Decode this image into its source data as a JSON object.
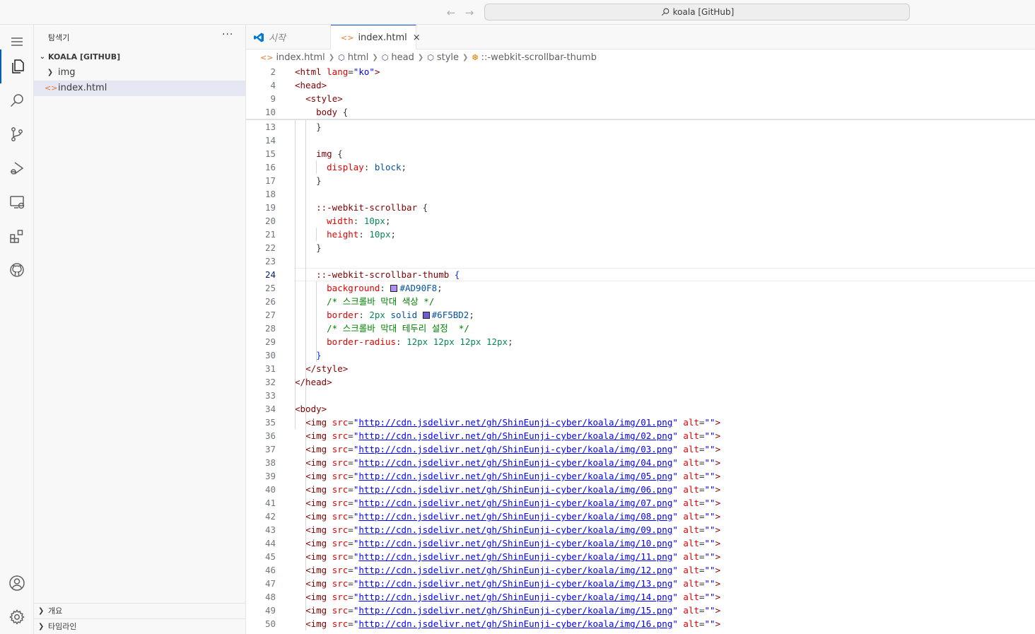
{
  "titlebar": {
    "search_text": "koala [GitHub]",
    "back_icon": "arrow-left-icon",
    "forward_icon": "arrow-right-icon"
  },
  "activity_bar": {
    "items": [
      "explorer",
      "search",
      "source-control",
      "run-and-debug",
      "remote-explorer",
      "extensions",
      "github"
    ],
    "bottom": [
      "accounts",
      "manage"
    ]
  },
  "sidebar": {
    "title": "탐색기",
    "more": "···",
    "root_label": "KOALA [GITHUB]",
    "folder_label": "img",
    "file_label": "index.html",
    "outline_label": "개요",
    "timeline_label": "타임라인"
  },
  "tabs": {
    "welcome": "시작",
    "index": "index.html",
    "close": "×"
  },
  "breadcrumb": {
    "file": "index.html",
    "html": "html",
    "head": "head",
    "style": "style",
    "selector": "::-webkit-scrollbar-thumb"
  },
  "colors": {
    "swatch1": "#AD90F8",
    "swatch2": "#6F5BD2",
    "accent": "#005fb8"
  },
  "editor": {
    "current_line": "24",
    "sticky": [
      {
        "n": "2",
        "indent": "",
        "tokens": [
          [
            "t-tag",
            "<html "
          ],
          [
            "t-attr",
            "lang"
          ],
          [
            "t-pun",
            "="
          ],
          [
            "t-str",
            "\"ko\""
          ],
          [
            "t-tag",
            ">"
          ]
        ]
      },
      {
        "n": "4",
        "indent": "",
        "tokens": [
          [
            "t-tag",
            "<head>"
          ]
        ]
      },
      {
        "n": "9",
        "indent": "  ",
        "tokens": [
          [
            "t-tag",
            "<style>"
          ]
        ]
      },
      {
        "n": "10",
        "indent": "    ",
        "tokens": [
          [
            "t-sel",
            "body "
          ],
          [
            "t-pun",
            "{"
          ]
        ]
      }
    ],
    "lines": [
      {
        "n": "13",
        "indent": "    ",
        "tokens": [
          [
            "t-pun",
            "}"
          ]
        ]
      },
      {
        "n": "14",
        "indent": "",
        "tokens": []
      },
      {
        "n": "15",
        "indent": "    ",
        "tokens": [
          [
            "t-sel",
            "img "
          ],
          [
            "t-pun",
            "{"
          ]
        ]
      },
      {
        "n": "16",
        "indent": "      ",
        "tokens": [
          [
            "t-prop",
            "display"
          ],
          [
            "t-pun",
            ": "
          ],
          [
            "t-val",
            "block"
          ],
          [
            "t-pun",
            ";"
          ]
        ]
      },
      {
        "n": "17",
        "indent": "    ",
        "tokens": [
          [
            "t-pun",
            "}"
          ]
        ]
      },
      {
        "n": "18",
        "indent": "",
        "tokens": []
      },
      {
        "n": "19",
        "indent": "    ",
        "tokens": [
          [
            "t-sel",
            "::-webkit-scrollbar "
          ],
          [
            "t-pun",
            "{"
          ]
        ]
      },
      {
        "n": "20",
        "indent": "      ",
        "tokens": [
          [
            "t-prop",
            "width"
          ],
          [
            "t-pun",
            ": "
          ],
          [
            "t-num",
            "10px"
          ],
          [
            "t-pun",
            ";"
          ]
        ]
      },
      {
        "n": "21",
        "indent": "      ",
        "tokens": [
          [
            "t-prop",
            "height"
          ],
          [
            "t-pun",
            ": "
          ],
          [
            "t-num",
            "10px"
          ],
          [
            "t-pun",
            ";"
          ]
        ]
      },
      {
        "n": "22",
        "indent": "    ",
        "tokens": [
          [
            "t-pun",
            "}"
          ]
        ]
      },
      {
        "n": "23",
        "indent": "",
        "tokens": []
      },
      {
        "n": "24",
        "indent": "    ",
        "tokens": [
          [
            "t-sel",
            "::-webkit-scrollbar-thumb "
          ],
          [
            "t-brace",
            "{"
          ]
        ]
      },
      {
        "n": "25",
        "indent": "      ",
        "tokens": [
          [
            "t-prop",
            "background"
          ],
          [
            "t-pun",
            ": "
          ],
          [
            "swatch",
            "#AD90F8"
          ],
          [
            "t-val",
            "#AD90F8"
          ],
          [
            "t-pun",
            ";"
          ]
        ]
      },
      {
        "n": "26",
        "indent": "      ",
        "tokens": [
          [
            "t-com",
            "/* 스크롤바 막대 색상 */"
          ]
        ]
      },
      {
        "n": "27",
        "indent": "      ",
        "tokens": [
          [
            "t-prop",
            "border"
          ],
          [
            "t-pun",
            ": "
          ],
          [
            "t-num",
            "2px "
          ],
          [
            "t-val",
            "solid "
          ],
          [
            "swatch",
            "#6F5BD2"
          ],
          [
            "t-val",
            "#6F5BD2"
          ],
          [
            "t-pun",
            ";"
          ]
        ]
      },
      {
        "n": "28",
        "indent": "      ",
        "tokens": [
          [
            "t-com",
            "/* 스크롤바 막대 테두리 설정  */"
          ]
        ]
      },
      {
        "n": "29",
        "indent": "      ",
        "tokens": [
          [
            "t-prop",
            "border-radius"
          ],
          [
            "t-pun",
            ": "
          ],
          [
            "t-num",
            "12px 12px 12px 12px"
          ],
          [
            "t-pun",
            ";"
          ]
        ]
      },
      {
        "n": "30",
        "indent": "    ",
        "tokens": [
          [
            "t-brace",
            "}"
          ]
        ]
      },
      {
        "n": "31",
        "indent": "  ",
        "tokens": [
          [
            "t-tag",
            "</style>"
          ]
        ]
      },
      {
        "n": "32",
        "indent": "",
        "tokens": [
          [
            "t-tag",
            "</head>"
          ]
        ]
      },
      {
        "n": "33",
        "indent": "",
        "tokens": []
      },
      {
        "n": "34",
        "indent": "",
        "tokens": [
          [
            "t-tag",
            "<body>"
          ]
        ]
      },
      {
        "n": "35",
        "indent": "  ",
        "tokens": [
          [
            "t-tag",
            "<img "
          ],
          [
            "t-attr",
            "src"
          ],
          [
            "t-pun",
            "="
          ],
          [
            "t-str",
            "\""
          ],
          [
            "t-link",
            "http://cdn.jsdelivr.net/gh/ShinEunji-cyber/koala/img/01.png"
          ],
          [
            "t-str",
            "\" "
          ],
          [
            "t-attr",
            "alt"
          ],
          [
            "t-pun",
            "="
          ],
          [
            "t-str",
            "\"\""
          ],
          [
            "t-tag",
            ">"
          ]
        ]
      },
      {
        "n": "36",
        "indent": "  ",
        "tokens": [
          [
            "t-tag",
            "<img "
          ],
          [
            "t-attr",
            "src"
          ],
          [
            "t-pun",
            "="
          ],
          [
            "t-str",
            "\""
          ],
          [
            "t-link",
            "http://cdn.jsdelivr.net/gh/ShinEunji-cyber/koala/img/02.png"
          ],
          [
            "t-str",
            "\" "
          ],
          [
            "t-attr",
            "alt"
          ],
          [
            "t-pun",
            "="
          ],
          [
            "t-str",
            "\"\""
          ],
          [
            "t-tag",
            ">"
          ]
        ]
      },
      {
        "n": "37",
        "indent": "  ",
        "tokens": [
          [
            "t-tag",
            "<img "
          ],
          [
            "t-attr",
            "src"
          ],
          [
            "t-pun",
            "="
          ],
          [
            "t-str",
            "\""
          ],
          [
            "t-link",
            "http://cdn.jsdelivr.net/gh/ShinEunji-cyber/koala/img/03.png"
          ],
          [
            "t-str",
            "\" "
          ],
          [
            "t-attr",
            "alt"
          ],
          [
            "t-pun",
            "="
          ],
          [
            "t-str",
            "\"\""
          ],
          [
            "t-tag",
            ">"
          ]
        ]
      },
      {
        "n": "38",
        "indent": "  ",
        "tokens": [
          [
            "t-tag",
            "<img "
          ],
          [
            "t-attr",
            "src"
          ],
          [
            "t-pun",
            "="
          ],
          [
            "t-str",
            "\""
          ],
          [
            "t-link",
            "http://cdn.jsdelivr.net/gh/ShinEunji-cyber/koala/img/04.png"
          ],
          [
            "t-str",
            "\" "
          ],
          [
            "t-attr",
            "alt"
          ],
          [
            "t-pun",
            "="
          ],
          [
            "t-str",
            "\"\""
          ],
          [
            "t-tag",
            ">"
          ]
        ]
      },
      {
        "n": "39",
        "indent": "  ",
        "tokens": [
          [
            "t-tag",
            "<img "
          ],
          [
            "t-attr",
            "src"
          ],
          [
            "t-pun",
            "="
          ],
          [
            "t-str",
            "\""
          ],
          [
            "t-link",
            "http://cdn.jsdelivr.net/gh/ShinEunji-cyber/koala/img/05.png"
          ],
          [
            "t-str",
            "\" "
          ],
          [
            "t-attr",
            "alt"
          ],
          [
            "t-pun",
            "="
          ],
          [
            "t-str",
            "\"\""
          ],
          [
            "t-tag",
            ">"
          ]
        ]
      },
      {
        "n": "40",
        "indent": "  ",
        "tokens": [
          [
            "t-tag",
            "<img "
          ],
          [
            "t-attr",
            "src"
          ],
          [
            "t-pun",
            "="
          ],
          [
            "t-str",
            "\""
          ],
          [
            "t-link",
            "http://cdn.jsdelivr.net/gh/ShinEunji-cyber/koala/img/06.png"
          ],
          [
            "t-str",
            "\" "
          ],
          [
            "t-attr",
            "alt"
          ],
          [
            "t-pun",
            "="
          ],
          [
            "t-str",
            "\"\""
          ],
          [
            "t-tag",
            ">"
          ]
        ]
      },
      {
        "n": "41",
        "indent": "  ",
        "tokens": [
          [
            "t-tag",
            "<img "
          ],
          [
            "t-attr",
            "src"
          ],
          [
            "t-pun",
            "="
          ],
          [
            "t-str",
            "\""
          ],
          [
            "t-link",
            "http://cdn.jsdelivr.net/gh/ShinEunji-cyber/koala/img/07.png"
          ],
          [
            "t-str",
            "\" "
          ],
          [
            "t-attr",
            "alt"
          ],
          [
            "t-pun",
            "="
          ],
          [
            "t-str",
            "\"\""
          ],
          [
            "t-tag",
            ">"
          ]
        ]
      },
      {
        "n": "42",
        "indent": "  ",
        "tokens": [
          [
            "t-tag",
            "<img "
          ],
          [
            "t-attr",
            "src"
          ],
          [
            "t-pun",
            "="
          ],
          [
            "t-str",
            "\""
          ],
          [
            "t-link",
            "http://cdn.jsdelivr.net/gh/ShinEunji-cyber/koala/img/08.png"
          ],
          [
            "t-str",
            "\" "
          ],
          [
            "t-attr",
            "alt"
          ],
          [
            "t-pun",
            "="
          ],
          [
            "t-str",
            "\"\""
          ],
          [
            "t-tag",
            ">"
          ]
        ]
      },
      {
        "n": "43",
        "indent": "  ",
        "tokens": [
          [
            "t-tag",
            "<img "
          ],
          [
            "t-attr",
            "src"
          ],
          [
            "t-pun",
            "="
          ],
          [
            "t-str",
            "\""
          ],
          [
            "t-link",
            "http://cdn.jsdelivr.net/gh/ShinEunji-cyber/koala/img/09.png"
          ],
          [
            "t-str",
            "\" "
          ],
          [
            "t-attr",
            "alt"
          ],
          [
            "t-pun",
            "="
          ],
          [
            "t-str",
            "\"\""
          ],
          [
            "t-tag",
            ">"
          ]
        ]
      },
      {
        "n": "44",
        "indent": "  ",
        "tokens": [
          [
            "t-tag",
            "<img "
          ],
          [
            "t-attr",
            "src"
          ],
          [
            "t-pun",
            "="
          ],
          [
            "t-str",
            "\""
          ],
          [
            "t-link",
            "http://cdn.jsdelivr.net/gh/ShinEunji-cyber/koala/img/10.png"
          ],
          [
            "t-str",
            "\" "
          ],
          [
            "t-attr",
            "alt"
          ],
          [
            "t-pun",
            "="
          ],
          [
            "t-str",
            "\"\""
          ],
          [
            "t-tag",
            ">"
          ]
        ]
      },
      {
        "n": "45",
        "indent": "  ",
        "tokens": [
          [
            "t-tag",
            "<img "
          ],
          [
            "t-attr",
            "src"
          ],
          [
            "t-pun",
            "="
          ],
          [
            "t-str",
            "\""
          ],
          [
            "t-link",
            "http://cdn.jsdelivr.net/gh/ShinEunji-cyber/koala/img/11.png"
          ],
          [
            "t-str",
            "\" "
          ],
          [
            "t-attr",
            "alt"
          ],
          [
            "t-pun",
            "="
          ],
          [
            "t-str",
            "\"\""
          ],
          [
            "t-tag",
            ">"
          ]
        ]
      },
      {
        "n": "46",
        "indent": "  ",
        "tokens": [
          [
            "t-tag",
            "<img "
          ],
          [
            "t-attr",
            "src"
          ],
          [
            "t-pun",
            "="
          ],
          [
            "t-str",
            "\""
          ],
          [
            "t-link",
            "http://cdn.jsdelivr.net/gh/ShinEunji-cyber/koala/img/12.png"
          ],
          [
            "t-str",
            "\" "
          ],
          [
            "t-attr",
            "alt"
          ],
          [
            "t-pun",
            "="
          ],
          [
            "t-str",
            "\"\""
          ],
          [
            "t-tag",
            ">"
          ]
        ]
      },
      {
        "n": "47",
        "indent": "  ",
        "tokens": [
          [
            "t-tag",
            "<img "
          ],
          [
            "t-attr",
            "src"
          ],
          [
            "t-pun",
            "="
          ],
          [
            "t-str",
            "\""
          ],
          [
            "t-link",
            "http://cdn.jsdelivr.net/gh/ShinEunji-cyber/koala/img/13.png"
          ],
          [
            "t-str",
            "\" "
          ],
          [
            "t-attr",
            "alt"
          ],
          [
            "t-pun",
            "="
          ],
          [
            "t-str",
            "\"\""
          ],
          [
            "t-tag",
            ">"
          ]
        ]
      },
      {
        "n": "48",
        "indent": "  ",
        "tokens": [
          [
            "t-tag",
            "<img "
          ],
          [
            "t-attr",
            "src"
          ],
          [
            "t-pun",
            "="
          ],
          [
            "t-str",
            "\""
          ],
          [
            "t-link",
            "http://cdn.jsdelivr.net/gh/ShinEunji-cyber/koala/img/14.png"
          ],
          [
            "t-str",
            "\" "
          ],
          [
            "t-attr",
            "alt"
          ],
          [
            "t-pun",
            "="
          ],
          [
            "t-str",
            "\"\""
          ],
          [
            "t-tag",
            ">"
          ]
        ]
      },
      {
        "n": "49",
        "indent": "  ",
        "tokens": [
          [
            "t-tag",
            "<img "
          ],
          [
            "t-attr",
            "src"
          ],
          [
            "t-pun",
            "="
          ],
          [
            "t-str",
            "\""
          ],
          [
            "t-link",
            "http://cdn.jsdelivr.net/gh/ShinEunji-cyber/koala/img/15.png"
          ],
          [
            "t-str",
            "\" "
          ],
          [
            "t-attr",
            "alt"
          ],
          [
            "t-pun",
            "="
          ],
          [
            "t-str",
            "\"\""
          ],
          [
            "t-tag",
            ">"
          ]
        ]
      },
      {
        "n": "50",
        "indent": "  ",
        "tokens": [
          [
            "t-tag",
            "<img "
          ],
          [
            "t-attr",
            "src"
          ],
          [
            "t-pun",
            "="
          ],
          [
            "t-str",
            "\""
          ],
          [
            "t-link",
            "http://cdn.jsdelivr.net/gh/ShinEunji-cyber/koala/img/16.png"
          ],
          [
            "t-str",
            "\" "
          ],
          [
            "t-attr",
            "alt"
          ],
          [
            "t-pun",
            "="
          ],
          [
            "t-str",
            "\"\""
          ],
          [
            "t-tag",
            ">"
          ]
        ]
      }
    ]
  }
}
